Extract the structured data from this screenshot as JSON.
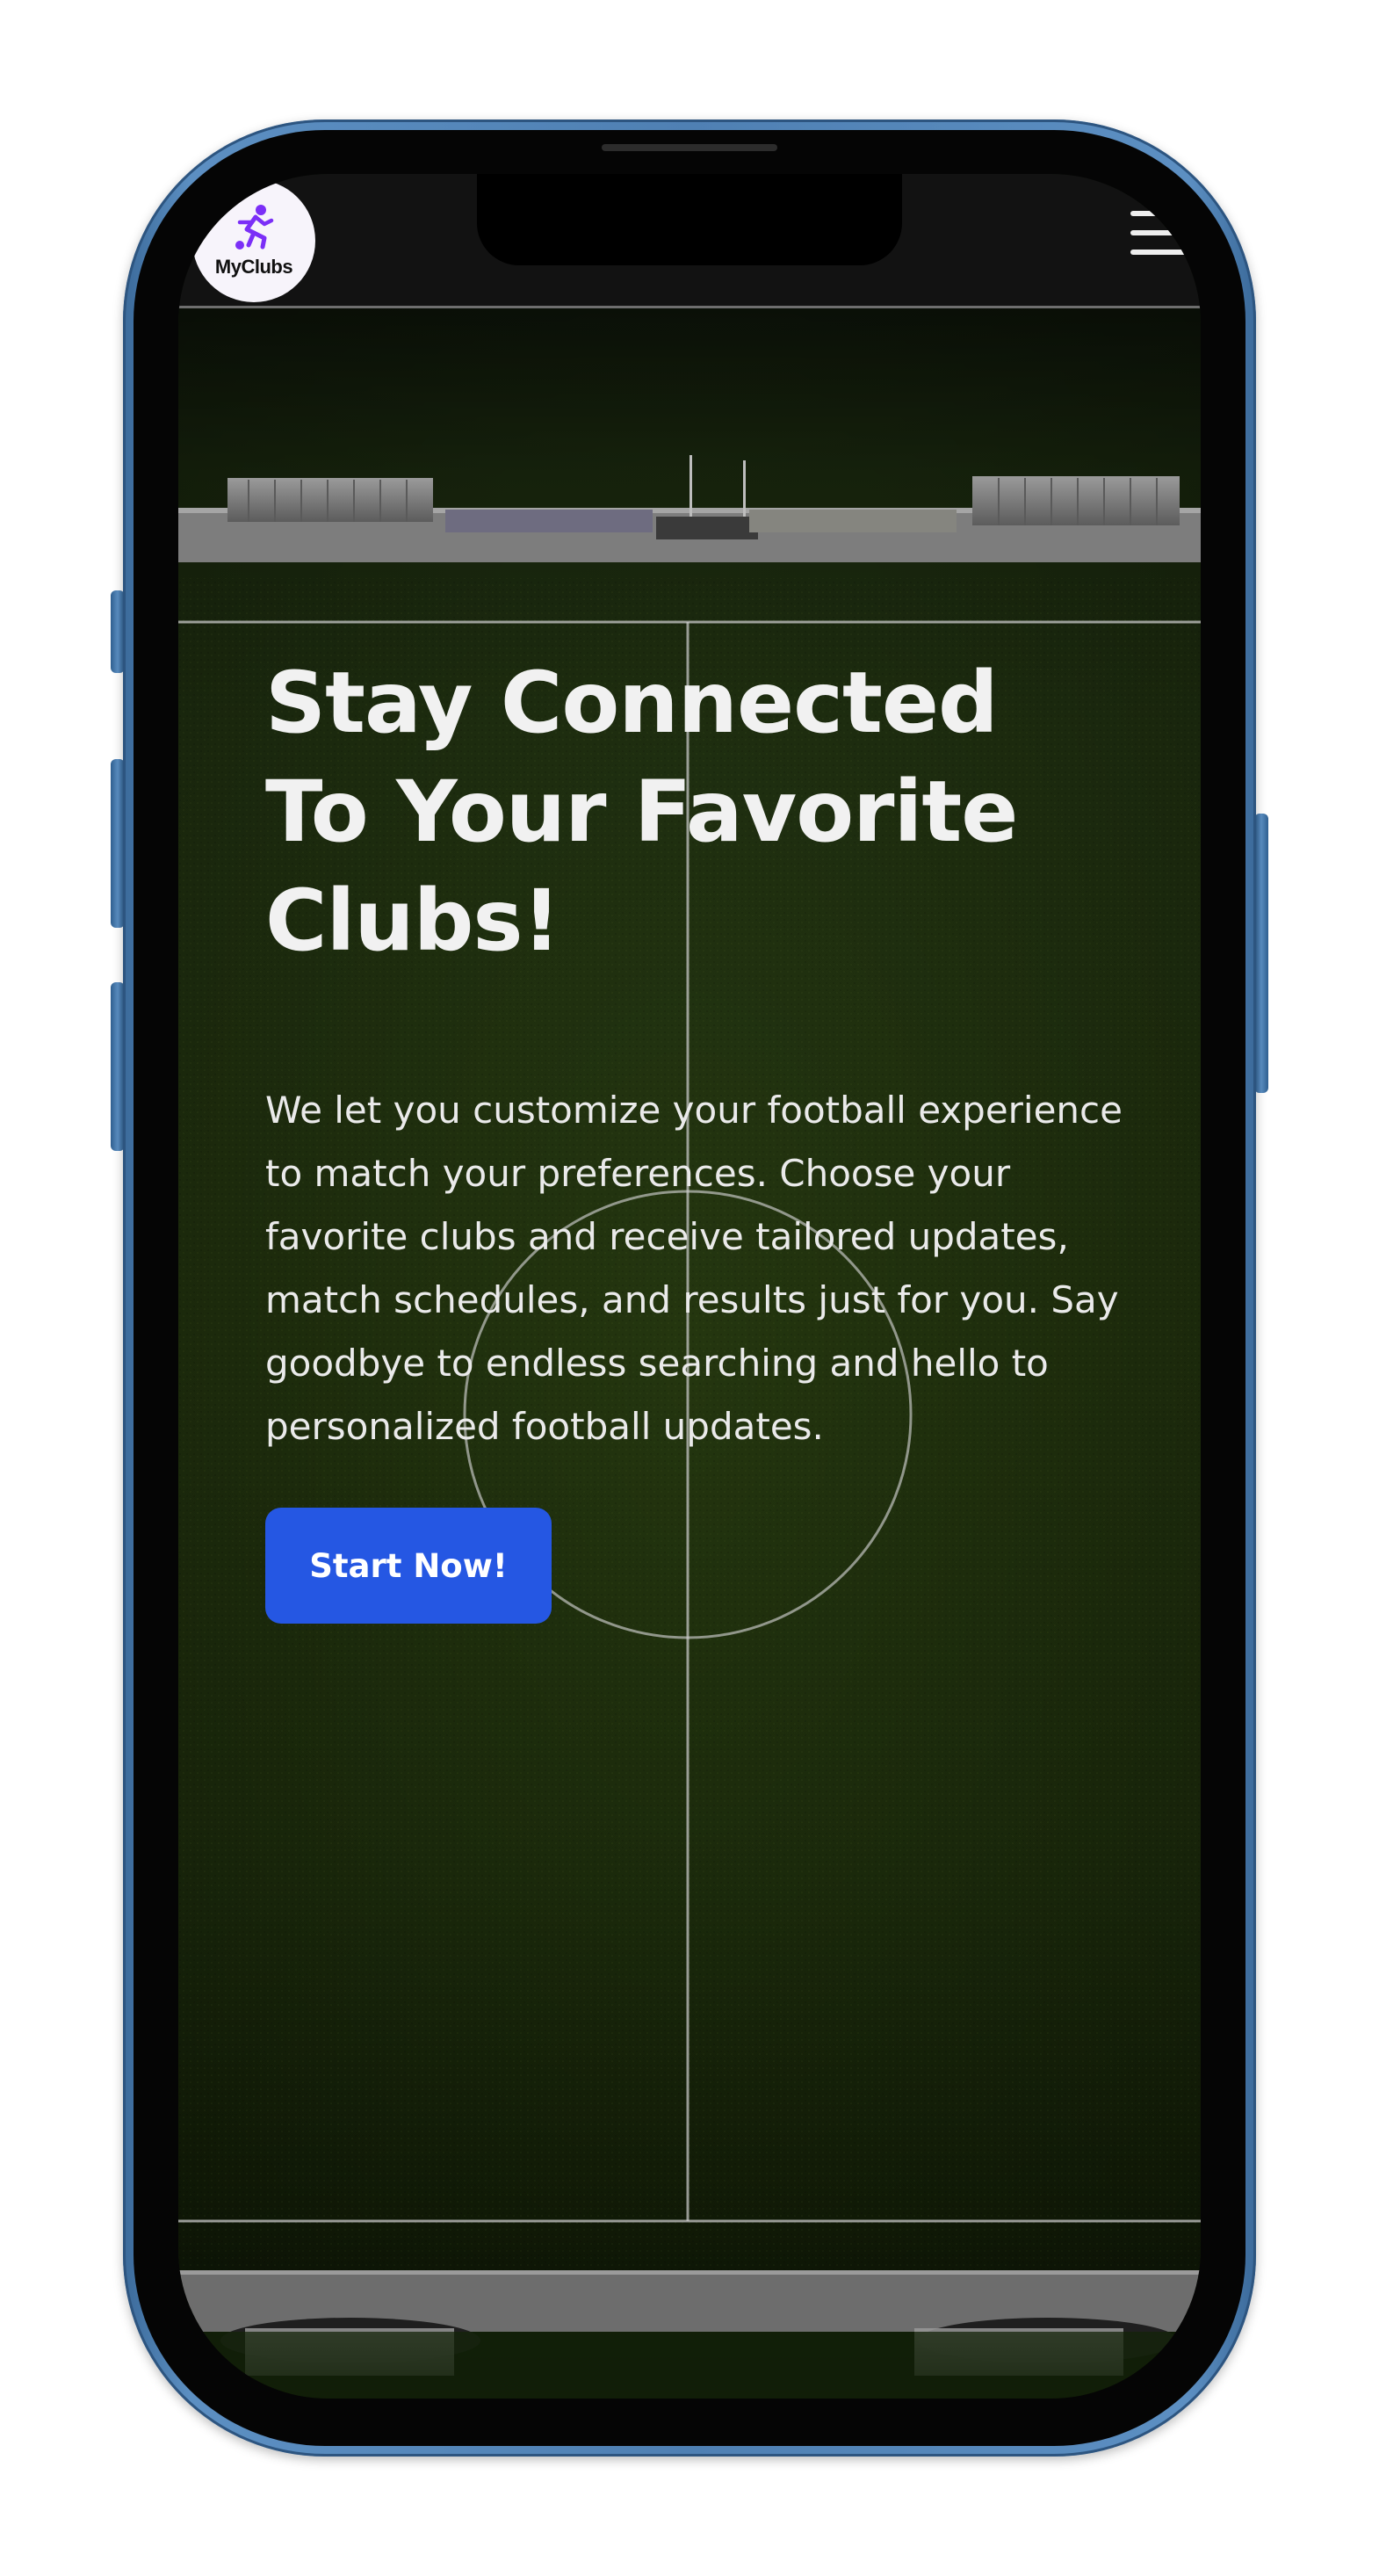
{
  "brand": {
    "logo_text": "MyClubs",
    "logo_icon": "soccer-player-icon",
    "accent_color": "#7b2ff7"
  },
  "nav": {
    "menu_icon": "hamburger-menu-icon"
  },
  "hero": {
    "title": "Stay Connected To Your Favorite Clubs!",
    "description": "We let you customize your football experience to match your preferences. Choose your favorite clubs and receive tailored updates, match schedules, and results just for you. Say goodbye to endless searching and hello to personalized football updates.",
    "cta_label": "Start Now!",
    "cta_color": "#2557e3",
    "background": "football-pitch-aerial-photo"
  },
  "device": {
    "frame_color": "#4f80b3"
  }
}
